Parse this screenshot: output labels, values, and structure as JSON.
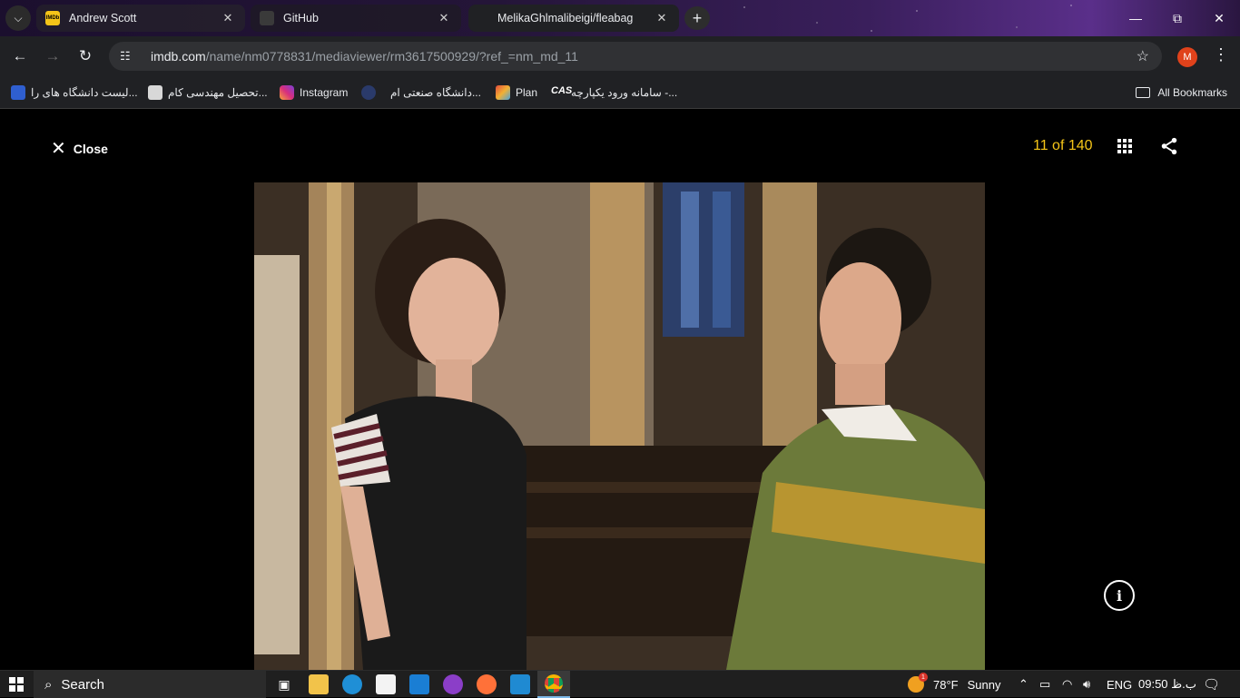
{
  "browser": {
    "tabs": [
      {
        "title": "Andrew Scott",
        "favicon": "imdb-favicon"
      },
      {
        "title": "GitHub",
        "favicon": "github-favicon"
      },
      {
        "title": "MelikaGhlmalibeigi/fleabag",
        "favicon": "none"
      }
    ],
    "address": {
      "host": "imdb.com",
      "path": "/name/nm0778831/mediaviewer/rm3617500929/?ref_=nm_md_11"
    },
    "profile_initial": "M",
    "bookmarks": [
      {
        "label": "لیست دانشگاه های را...",
        "icon": "ze-icon"
      },
      {
        "label": "تحصیل مهندسی کام...",
        "icon": "doc-icon"
      },
      {
        "label": "Instagram",
        "icon": "instagram-icon"
      },
      {
        "label": "دانشگاه صنعتی ام...",
        "icon": "university-icon"
      },
      {
        "label": "Plan",
        "icon": "plan-icon"
      },
      {
        "label": "سامانه ورود یکپارچه -...",
        "icon": "cas-icon"
      }
    ],
    "all_bookmarks_label": "All Bookmarks"
  },
  "viewer": {
    "close_label": "Close",
    "counter": "11 of 140",
    "info_glyph": "i",
    "accent_color": "#f5c518"
  },
  "taskbar": {
    "search_label": "Search",
    "weather_temp": "78°F",
    "weather_text": "Sunny",
    "weather_badge": "1",
    "language": "ENG",
    "time": "09:50 ب.ظ"
  }
}
